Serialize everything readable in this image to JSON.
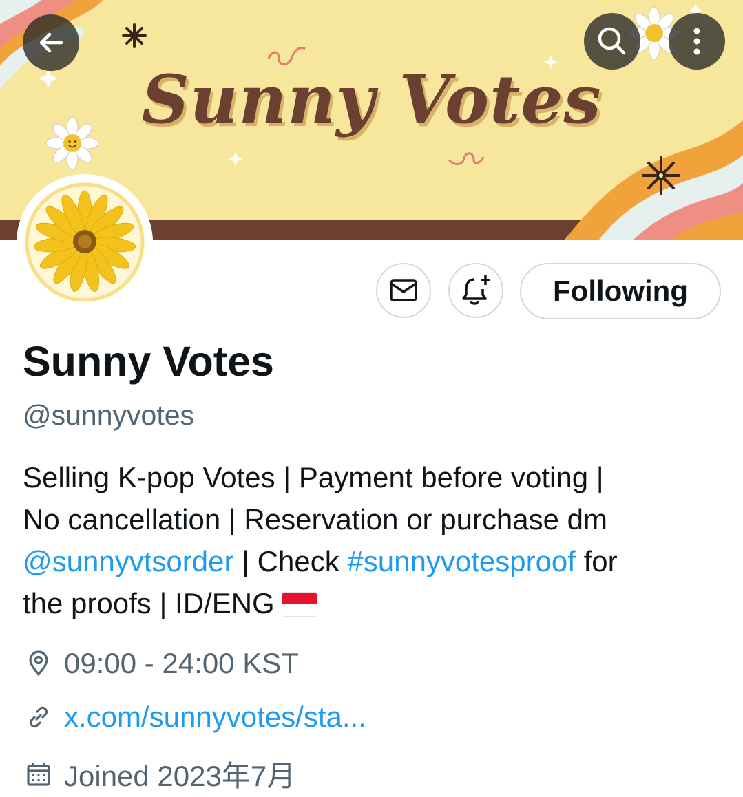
{
  "banner": {
    "title": "Sunny Votes",
    "colors": {
      "background": "#f6e79c",
      "stripe_brown": "#6b4030",
      "orange": "#f2a23a",
      "pink": "#ef8f84"
    }
  },
  "nav": {
    "back_icon": "arrow-left-icon",
    "search_icon": "search-icon",
    "more_icon": "more-vertical-icon"
  },
  "actions": {
    "message_icon": "envelope-icon",
    "notify_icon": "bell-plus-icon",
    "follow_label": "Following"
  },
  "profile": {
    "display_name": "Sunny Votes",
    "handle": "@sunnyvotes",
    "bio": {
      "line1": "Selling K-pop Votes | Payment before voting |",
      "line2": "No cancellation | Reservation or purchase dm",
      "mention": "@sunnyvtsorder",
      "mid": " | Check ",
      "hashtag": "#sunnyvotesproof",
      "after_hashtag": " for",
      "line4": "the proofs | ID/ENG "
    },
    "location_icon": "location-pin-icon",
    "location": "09:00 - 24:00 KST",
    "link_icon": "link-icon",
    "website": "x.com/sunnyvotes/sta...",
    "joined_icon": "calendar-icon",
    "joined": "Joined 2023年7月"
  },
  "accent_color": "#1d9bf0"
}
